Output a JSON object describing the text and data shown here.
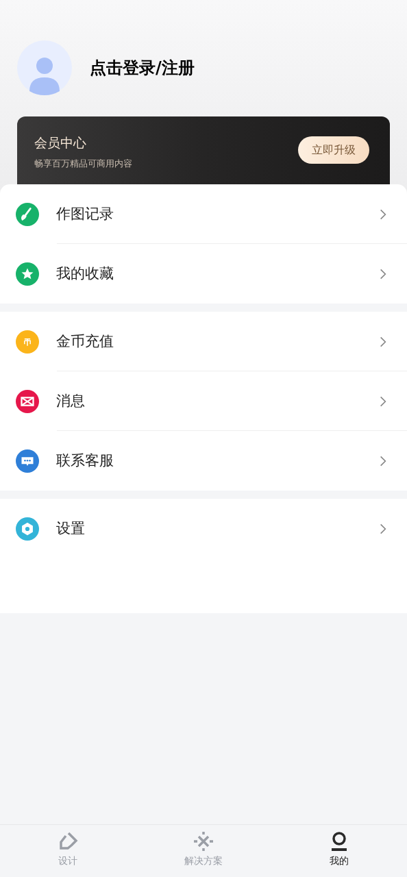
{
  "profile": {
    "login_text": "点击登录/注册"
  },
  "vip_card": {
    "title": "会员中心",
    "subtitle": "畅享百万精品可商用内容",
    "button": "立即升级"
  },
  "menu_groups": [
    {
      "items": [
        {
          "label": "作图记录",
          "kind": "brush",
          "color": "#17b26a"
        },
        {
          "label": "我的收藏",
          "kind": "star",
          "color": "#17b26a"
        }
      ]
    },
    {
      "items": [
        {
          "label": "金币充值",
          "kind": "coin",
          "color": "#fbb41a"
        },
        {
          "label": "消息",
          "kind": "mail",
          "color": "#e6174b"
        },
        {
          "label": "联系客服",
          "kind": "chat",
          "color": "#2f7fd8"
        }
      ]
    },
    {
      "items": [
        {
          "label": "设置",
          "kind": "gear",
          "color": "#33b4d8"
        }
      ]
    }
  ],
  "tabs": [
    {
      "label": "设计",
      "kind": "design",
      "selected": false
    },
    {
      "label": "解决方案",
      "kind": "solution",
      "selected": false
    },
    {
      "label": "我的",
      "kind": "me",
      "selected": true
    }
  ]
}
